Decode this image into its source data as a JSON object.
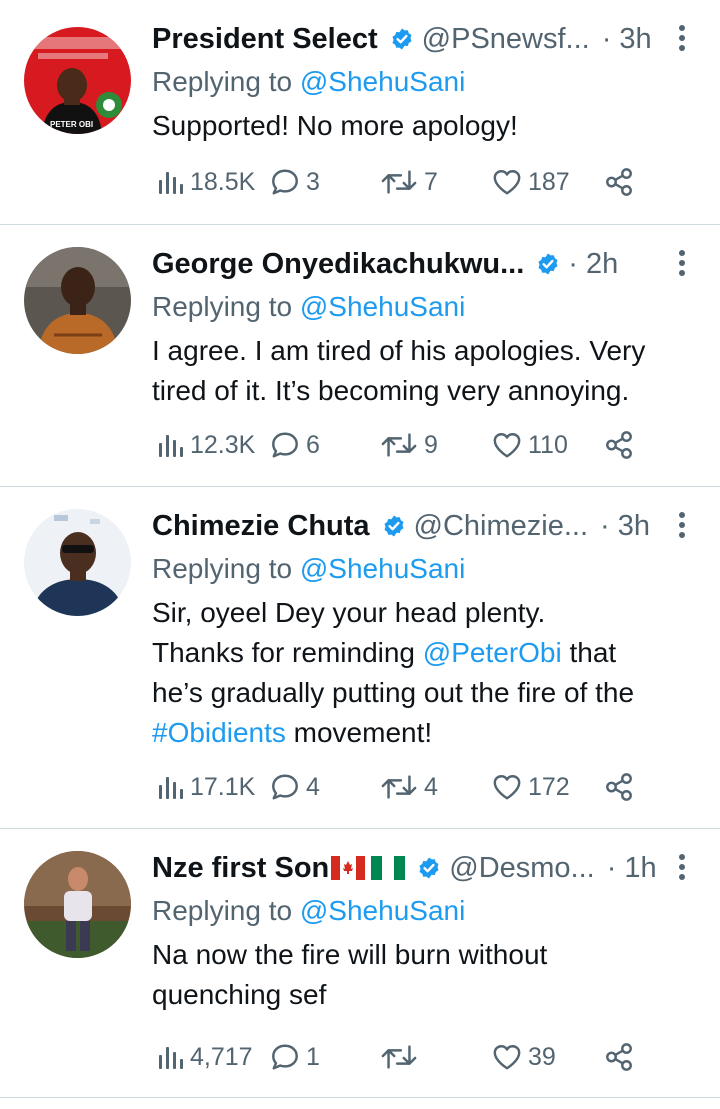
{
  "tweets": [
    {
      "name": "President Select",
      "handle": "@PSnewsf...",
      "time": "· 3h",
      "replying_prefix": "Replying to ",
      "replying_to": "@ShehuSani",
      "text": "Supported! No more apology!",
      "views": "18.5K",
      "replies": "3",
      "retweets": "7",
      "likes": "187",
      "avatar_text": "PETER OBI"
    },
    {
      "name": "George Onyedikachukwu...",
      "handle": "",
      "time": "· 2h",
      "replying_prefix": "Replying to ",
      "replying_to": "@ShehuSani",
      "text_line1": "I agree. I am tired of his apologies. Very",
      "text_line2": "tired of it. It’s becoming very annoying.",
      "views": "12.3K",
      "replies": "6",
      "retweets": "9",
      "likes": "110"
    },
    {
      "name": "Chimezie Chuta",
      "handle": "@Chimezie...",
      "time": "· 3h",
      "replying_prefix": "Replying to ",
      "replying_to": "@ShehuSani",
      "text_line1": "Sir, oyeel Dey your head plenty.",
      "text_line2_a": "Thanks for reminding ",
      "text_line2_mention": "@PeterObi",
      "text_line2_b": " that",
      "text_line3": "he’s gradually putting out the fire of the",
      "text_line4_hashtag": "#Obidients",
      "text_line4_b": " movement!",
      "views": "17.1K",
      "replies": "4",
      "retweets": "4",
      "likes": "172"
    },
    {
      "name": "Nze first Son",
      "flags": [
        "canada-flag-icon",
        "nigeria-flag-icon"
      ],
      "handle": "@Desmo...",
      "time": "· 1h",
      "replying_prefix": "Replying to ",
      "replying_to": "@ShehuSani",
      "text_line1": "Na now the fire will burn without",
      "text_line2": "quenching sef",
      "views": "4,717",
      "replies": "1",
      "retweets": "",
      "likes": "39"
    }
  ],
  "colors": {
    "link": "#1d9bf0",
    "secondary": "#536471",
    "divider": "#cfd9de",
    "verified": "#1d9bf0"
  }
}
